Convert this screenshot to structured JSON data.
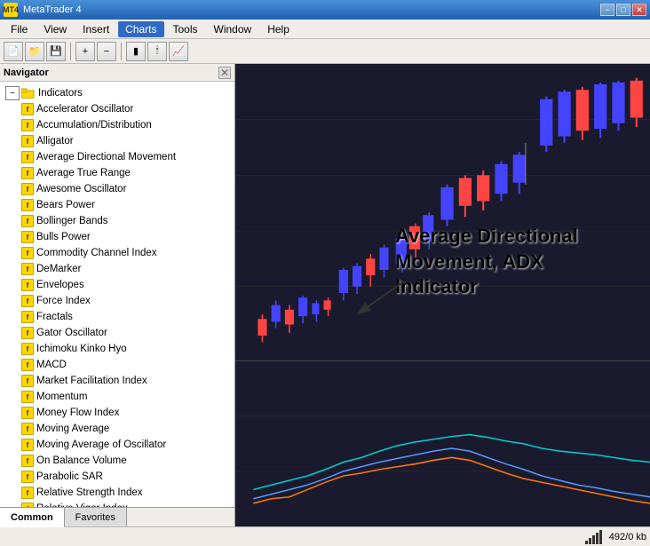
{
  "app": {
    "title": "MetaTrader 4",
    "icon_label": "MT4"
  },
  "title_bar": {
    "controls": [
      "−",
      "□",
      "✕"
    ]
  },
  "menu": {
    "items": [
      "File",
      "View",
      "Insert",
      "Charts",
      "Tools",
      "Window",
      "Help"
    ],
    "active": "Charts"
  },
  "navigator": {
    "title": "Navigator",
    "close_label": "✕",
    "tree": {
      "root_label": "Indicators",
      "items": [
        "Accelerator Oscillator",
        "Accumulation/Distribution",
        "Alligator",
        "Average Directional Movement",
        "Average True Range",
        "Awesome Oscillator",
        "Bears Power",
        "Bollinger Bands",
        "Bulls Power",
        "Commodity Channel Index",
        "DeMarker",
        "Envelopes",
        "Force Index",
        "Fractals",
        "Gator Oscillator",
        "Ichimoku Kinko Hyo",
        "MACD",
        "Market Facilitation Index",
        "Momentum",
        "Money Flow Index",
        "Moving Average",
        "Moving Average of Oscillator",
        "On Balance Volume",
        "Parabolic SAR",
        "Relative Strength Index",
        "Relative Vigor Index"
      ]
    },
    "tabs": [
      "Common",
      "Favorites"
    ]
  },
  "chart": {
    "annotation_line1": "Average Directional",
    "annotation_line2": "Movement, ADX",
    "annotation_line3": "Indicator"
  },
  "status_bar": {
    "coords": "492/0 kb"
  }
}
